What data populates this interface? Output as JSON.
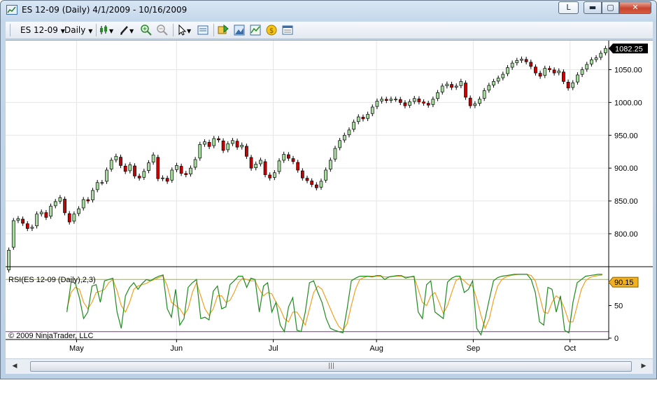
{
  "window": {
    "title": "ES 12-09 (Daily)  4/1/2009 - 10/16/2009",
    "caption_buttons": {
      "layout": "L",
      "minimize": "▬",
      "maximize": "▢",
      "close": "✕"
    }
  },
  "toolbar": {
    "instrument": "ES 12-09",
    "interval": "Daily",
    "icons": [
      "bar-style-icon",
      "drawing-pencil-icon",
      "zoom-in-icon",
      "zoom-out-icon",
      "cursor-icon",
      "data-box-icon",
      "strategy-icon",
      "chart-image-icon",
      "indicators-icon",
      "coin-icon",
      "properties-icon"
    ]
  },
  "chart_data": [
    {
      "type": "candlestick",
      "title": "",
      "price_axis_labels": [
        "1050.00",
        "1000.00",
        "950.00",
        "900.00",
        "850.00",
        "800.00"
      ],
      "price_ticks": [
        1050,
        1000,
        950,
        900,
        850,
        800
      ],
      "ylim": [
        753,
        1090
      ],
      "last_price_label": "1082.25",
      "last_price": 1082.25,
      "x_labels": [
        "May",
        "Jun",
        "Jul",
        "Aug",
        "Sep",
        "Oct"
      ],
      "x_label_days": [
        21,
        52,
        82,
        114,
        144,
        174
      ],
      "xlim": [
        -1,
        186
      ],
      "up_color": "#a8dfa0",
      "down_color": "#cc0000",
      "series": [
        {
          "closes": [
            775,
            820,
            823,
            816,
            808,
            810,
            830,
            833,
            825,
            842,
            849,
            855,
            832,
            818,
            830,
            838,
            852,
            850,
            866,
            878,
            878,
            897,
            912,
            918,
            904,
            895,
            905,
            888,
            885,
            895,
            908,
            920,
            884,
            885,
            880,
            897,
            904,
            892,
            890,
            900,
            913,
            936,
            940,
            933,
            945,
            943,
            927,
            937,
            942,
            932,
            935,
            918,
            900,
            906,
            912,
            890,
            885,
            893,
            911,
            921,
            915,
            910,
            897,
            885,
            881,
            875,
            870,
            880,
            897,
            912,
            930,
            942,
            950,
            958,
            970,
            978,
            975,
            982,
            993,
            1002,
            1005,
            1003,
            1005,
            1005,
            1000,
            995,
            1001,
            1006,
            1001,
            999,
            996,
            1005,
            1015,
            1025,
            1028,
            1023,
            1025,
            1032,
            1008,
            995,
            998,
            1005,
            1018,
            1026,
            1032,
            1037,
            1043,
            1053,
            1060,
            1064,
            1066,
            1062,
            1055,
            1045,
            1040,
            1052,
            1050,
            1045,
            1048,
            1032,
            1022,
            1030,
            1042,
            1050,
            1058,
            1065,
            1068,
            1075,
            1082.25
          ]
        }
      ]
    },
    {
      "type": "line",
      "title": "RSI(ES 12-09 (Daily),2,3)",
      "legend": "RSI(ES 12-09 (Daily),2,3)",
      "axis_labels": [
        "50",
        "0"
      ],
      "ticks": [
        50,
        0
      ],
      "ylim": [
        0,
        100
      ],
      "last_value_label": "90.15",
      "last_value": 90.15,
      "upper_line": 90,
      "lower_line": 10,
      "series": [
        {
          "name": "RSI",
          "color": "#1e8a1e",
          "values": [
            40,
            86,
            85,
            62,
            30,
            40,
            80,
            82,
            55,
            88,
            90,
            92,
            40,
            15,
            65,
            78,
            85,
            75,
            84,
            90,
            88,
            92,
            95,
            97,
            45,
            32,
            75,
            20,
            30,
            78,
            85,
            90,
            30,
            32,
            28,
            72,
            80,
            45,
            48,
            82,
            88,
            95,
            95,
            78,
            92,
            90,
            40,
            80,
            85,
            40,
            55,
            20,
            10,
            48,
            62,
            12,
            10,
            40,
            85,
            88,
            70,
            55,
            30,
            15,
            12,
            10,
            8,
            45,
            88,
            92,
            95,
            95,
            95,
            94,
            96,
            96,
            90,
            94,
            95,
            96,
            96,
            92,
            94,
            95,
            40,
            30,
            82,
            88,
            40,
            35,
            30,
            86,
            92,
            95,
            95,
            70,
            75,
            88,
            15,
            5,
            30,
            60,
            88,
            93,
            95,
            96,
            97,
            98,
            98,
            98,
            98,
            90,
            70,
            25,
            20,
            78,
            75,
            40,
            65,
            12,
            8,
            55,
            85,
            90,
            95,
            96,
            97,
            98,
            98
          ]
        },
        {
          "name": "Average",
          "color": "#f0a020",
          "values": [
            45,
            70,
            78,
            75,
            55,
            45,
            55,
            70,
            72,
            75,
            85,
            90,
            73,
            50,
            40,
            55,
            75,
            80,
            82,
            84,
            88,
            90,
            93,
            95,
            80,
            55,
            50,
            45,
            35,
            45,
            70,
            85,
            65,
            45,
            35,
            45,
            65,
            65,
            55,
            58,
            70,
            85,
            92,
            90,
            88,
            88,
            75,
            65,
            70,
            68,
            55,
            45,
            30,
            25,
            40,
            40,
            30,
            20,
            45,
            70,
            80,
            75,
            60,
            45,
            30,
            18,
            12,
            22,
            50,
            75,
            90,
            93,
            95,
            95,
            95,
            95,
            94,
            94,
            95,
            95,
            95,
            94,
            94,
            94,
            75,
            55,
            50,
            65,
            70,
            55,
            38,
            50,
            70,
            88,
            93,
            88,
            82,
            80,
            60,
            35,
            15,
            30,
            58,
            80,
            90,
            94,
            96,
            97,
            98,
            98,
            98,
            96,
            88,
            65,
            40,
            38,
            55,
            65,
            60,
            45,
            25,
            25,
            50,
            75,
            88,
            93,
            95,
            96,
            97
          ]
        }
      ]
    }
  ],
  "watermark": "© 2009 NinjaTrader, LLC",
  "scrollbar": {
    "left_arrow": "◀",
    "right_arrow": "▶",
    "grip": "|||"
  }
}
